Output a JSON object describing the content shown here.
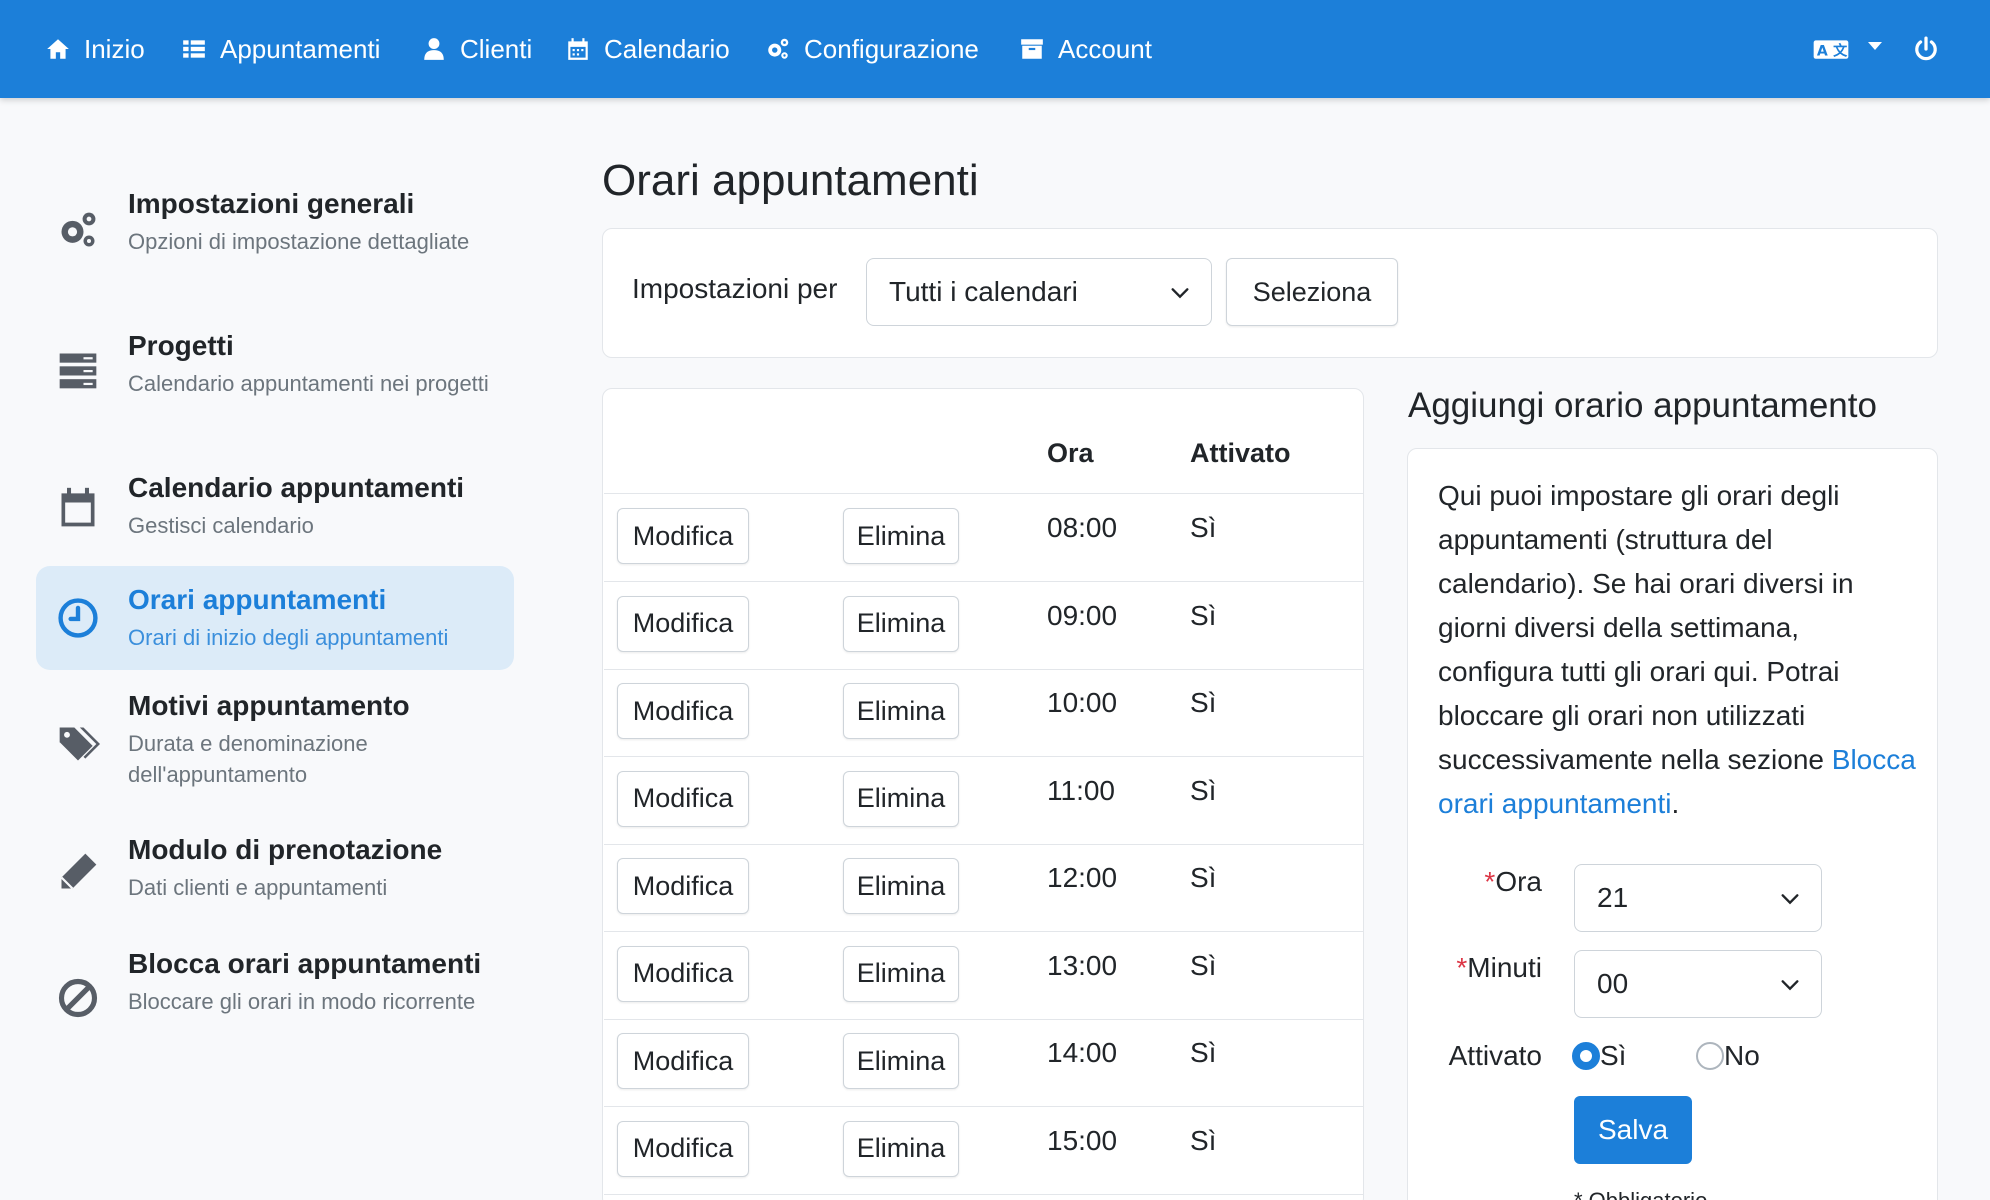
{
  "nav": {
    "items": [
      {
        "label": "Inizio",
        "icon": "home-icon"
      },
      {
        "label": "Appuntamenti",
        "icon": "list-icon"
      },
      {
        "label": "Clienti",
        "icon": "user-icon"
      },
      {
        "label": "Calendario",
        "icon": "calendar-icon"
      },
      {
        "label": "Configurazione",
        "icon": "cogs-icon"
      },
      {
        "label": "Account",
        "icon": "archive-icon"
      }
    ],
    "right_icons": [
      "language-icon",
      "power-icon"
    ]
  },
  "sidebar": {
    "items": [
      {
        "title": "Impostazioni generali",
        "desc": "Opzioni di impostazione dettagliate",
        "icon": "cogs-icon",
        "active": false
      },
      {
        "title": "Progetti",
        "desc": "Calendario appuntamenti nei progetti",
        "icon": "server-icon",
        "active": false
      },
      {
        "title": "Calendario appuntamenti",
        "desc": "Gestisci calendario",
        "icon": "calendar-icon",
        "active": false
      },
      {
        "title": "Orari appuntamenti",
        "desc": "Orari di inizio degli appuntamenti",
        "icon": "clock-icon",
        "active": true
      },
      {
        "title": "Motivi appuntamento",
        "desc": "Durata e denominazione dell'appuntamento",
        "icon": "tags-icon",
        "active": false
      },
      {
        "title": "Modulo di prenotazione",
        "desc": "Dati clienti e appuntamenti",
        "icon": "pencil-icon",
        "active": false
      },
      {
        "title": "Blocca orari appuntamenti",
        "desc": "Bloccare gli orari in modo ricorrente",
        "icon": "ban-icon",
        "active": false
      }
    ]
  },
  "main": {
    "title": "Orari appuntamenti",
    "filter": {
      "label": "Impostazioni per",
      "selected": "Tutti i calendari",
      "button": "Seleziona"
    },
    "table": {
      "headers": {
        "time": "Ora",
        "enabled": "Attivato"
      },
      "edit_label": "Modifica",
      "delete_label": "Elimina",
      "rows": [
        {
          "time": "08:00",
          "enabled": "Sì"
        },
        {
          "time": "09:00",
          "enabled": "Sì"
        },
        {
          "time": "10:00",
          "enabled": "Sì"
        },
        {
          "time": "11:00",
          "enabled": "Sì"
        },
        {
          "time": "12:00",
          "enabled": "Sì"
        },
        {
          "time": "13:00",
          "enabled": "Sì"
        },
        {
          "time": "14:00",
          "enabled": "Sì"
        },
        {
          "time": "15:00",
          "enabled": "Sì"
        }
      ]
    }
  },
  "add_panel": {
    "title": "Aggiungi orario appuntamento",
    "help_text": "Qui puoi impostare gli orari degli appuntamenti (struttura del calendario). Se hai orari diversi in giorni diversi della settimana, configura tutti gli orari qui. Potrai bloccare gli orari non utilizzati successivamente nella sezione ",
    "help_link": "Blocca orari appuntamenti",
    "help_end": ".",
    "hour_label": "Ora",
    "hour_value": "21",
    "minutes_label": "Minuti",
    "minutes_value": "00",
    "required_mark": "*",
    "enabled_label": "Attivato",
    "radio_yes": "Sì",
    "radio_no": "No",
    "radio_selected": "yes",
    "save_label": "Salva",
    "footnote": "* Obbligatorio"
  },
  "colors": {
    "brand": "#1c7fd9",
    "active_bg": "#dcebf8",
    "required": "#dc3545"
  }
}
